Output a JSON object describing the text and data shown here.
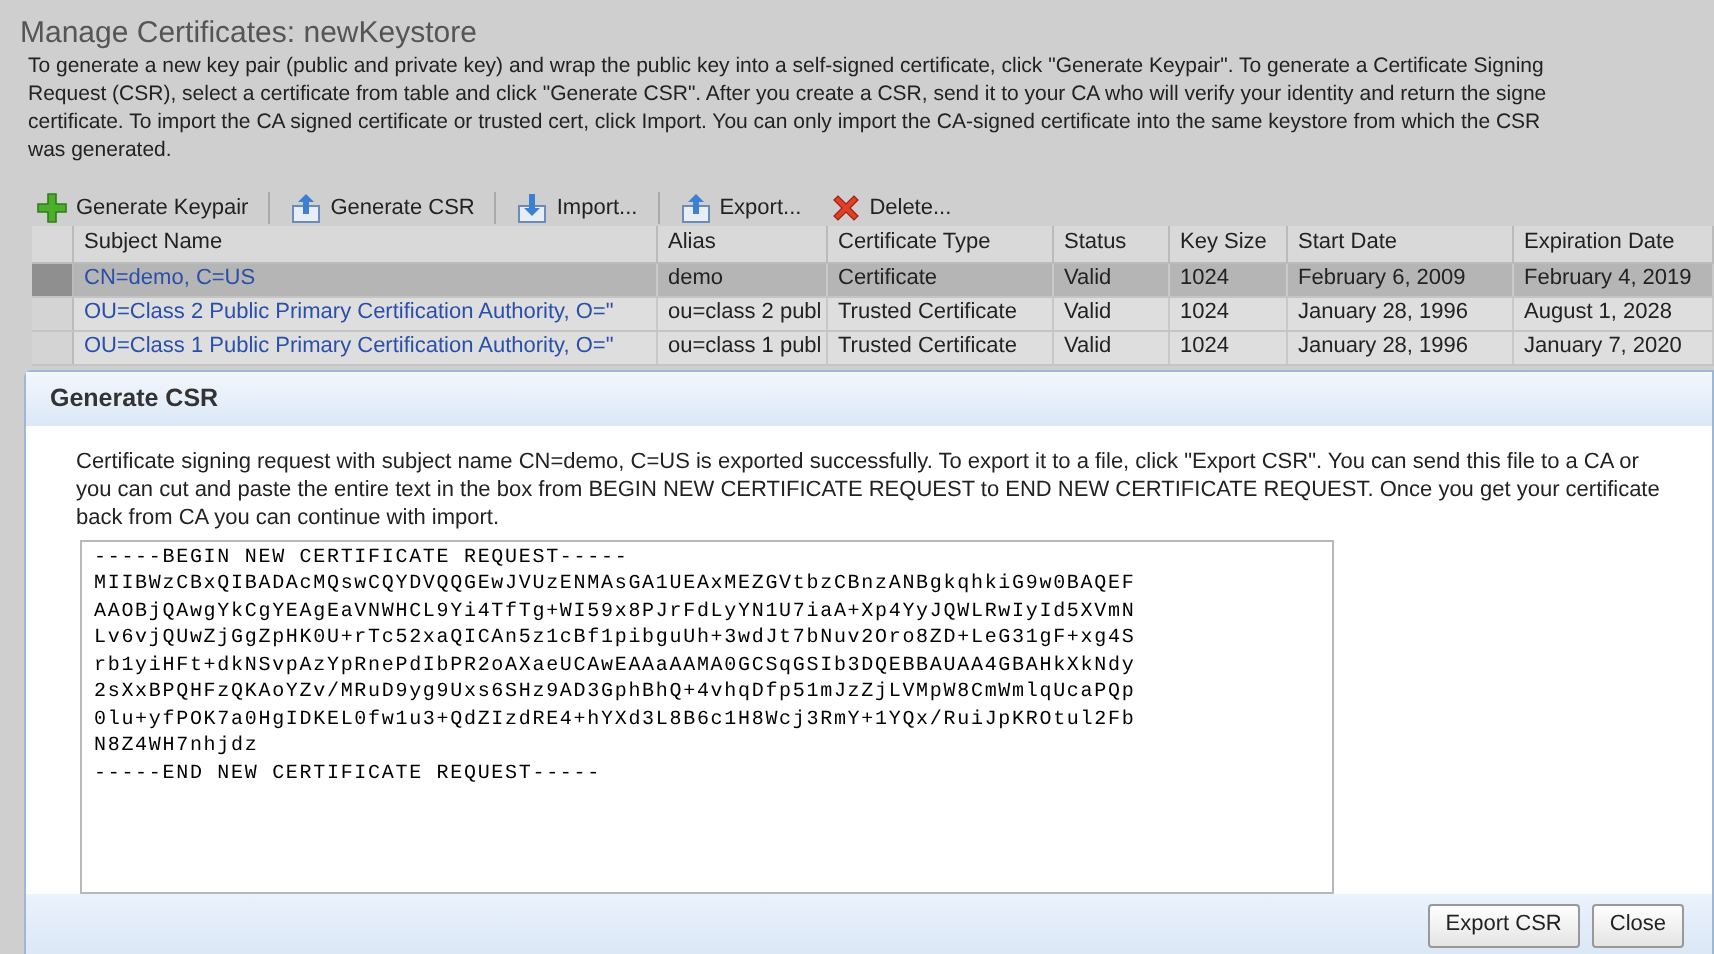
{
  "page": {
    "title": "Manage Certificates: newKeystore",
    "description_lines": [
      "To generate a new key pair (public and private key) and wrap the public key into a self-signed certificate, click \"Generate Keypair\". To generate a Certificate Signing",
      "Request (CSR), select a certificate from table and click \"Generate CSR\". After you create a CSR, send it to your CA who will verify your identity and return the signe",
      "certificate. To import the CA signed certificate or trusted cert, click Import. You can only import the CA-signed certificate into the same keystore from which the CSR",
      "was generated."
    ]
  },
  "toolbar": [
    {
      "label": "Generate Keypair",
      "kind": "add"
    },
    {
      "label": "Generate CSR",
      "kind": "upload"
    },
    {
      "label": "Import...",
      "kind": "download"
    },
    {
      "label": "Export...",
      "kind": "upload"
    },
    {
      "label": "Delete...",
      "kind": "delete"
    }
  ],
  "table": {
    "columns": [
      "Subject Name",
      "Alias",
      "Certificate Type",
      "Status",
      "Key Size",
      "Start Date",
      "Expiration Date"
    ],
    "rows": [
      {
        "selected": true,
        "cells": [
          "CN=demo, C=US",
          "demo",
          "Certificate",
          "Valid",
          "1024",
          "February 6, 2009",
          "February 4, 2019"
        ]
      },
      {
        "selected": false,
        "cells": [
          "OU=Class 2 Public Primary Certification Authority, O=\"",
          "ou=class 2 publ",
          "Trusted Certificate",
          "Valid",
          "1024",
          "January 28, 1996",
          "August 1, 2028"
        ]
      },
      {
        "selected": false,
        "cells": [
          "OU=Class 1 Public Primary Certification Authority, O=\"",
          "ou=class 1 publ",
          "Trusted Certificate",
          "Valid",
          "1024",
          "January 28, 1996",
          "January 7, 2020"
        ]
      }
    ]
  },
  "dialog": {
    "title": "Generate CSR",
    "message": "Certificate signing request with subject name CN=demo, C=US is exported successfully. To export it to a file, click \"Export CSR\". You can send this file to a CA or you can cut and paste the entire text in the box from BEGIN NEW CERTIFICATE REQUEST to END NEW CERTIFICATE REQUEST. Once you get your certificate back from CA you can continue with import.",
    "csr_lines": [
      "-----BEGIN NEW CERTIFICATE REQUEST-----",
      "MIIBWzCBxQIBADAcMQswCQYDVQQGEwJVUzENMAsGA1UEAxMEZGVtbzCBnzANBgkqhkiG9w0BAQEF",
      "AAOBjQAwgYkCgYEAgEaVNWHCL9Yi4TfTg+WI59x8PJrFdLyYN1U7iaA+Xp4YyJQWLRwIyId5XVmN",
      "Lv6vjQUwZjGgZpHK0U+rTc52xaQICAn5z1cBf1pibguUh+3wdJt7bNuv2Oro8ZD+LeG31gF+xg4S",
      "rb1yiHFt+dkNSvpAzYpRnePdIbPR2oAXaeUCAwEAAaAAMA0GCSqGSIb3DQEBBAUAA4GBAHkXkNdy",
      "2sXxBPQHFzQKAoYZv/MRuD9yg9Uxs6SHz9AD3GphBhQ+4vhqDfp51mJzZjLVMpW8CmWmlqUcaPQp",
      "0lu+yfPOK7a0HgIDKEL0fw1u3+QdZIzdRE4+hYXd3L8B6c1H8Wcj3RmY+1YQx/RuiJpKROtul2Fb",
      "N8Z4WH7nhjdz",
      "-----END NEW CERTIFICATE REQUEST-----"
    ],
    "buttons": [
      "Export CSR",
      "Close"
    ]
  }
}
